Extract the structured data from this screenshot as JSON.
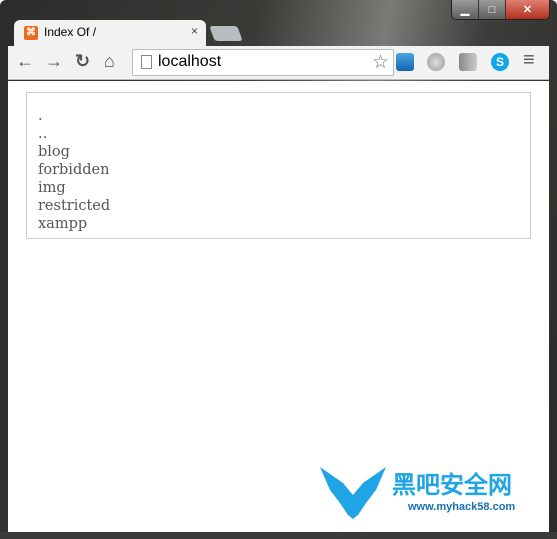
{
  "window": {
    "minimize": "▁",
    "maximize": "□",
    "close": "✕"
  },
  "tab": {
    "title": "Index Of /",
    "close": "×",
    "favicon": "xampp-icon"
  },
  "toolbar": {
    "back": "←",
    "forward": "→",
    "reload": "↻",
    "home": "⌂",
    "url": "localhost",
    "star": "☆",
    "menu": "≡"
  },
  "listing": {
    "entries": [
      ".",
      "..",
      "blog",
      "forbidden",
      "img",
      "restricted",
      "xampp"
    ]
  },
  "watermark": {
    "title": "黑吧安全网",
    "url": "www.myhack58.com",
    "color": "#1fa4e6"
  }
}
